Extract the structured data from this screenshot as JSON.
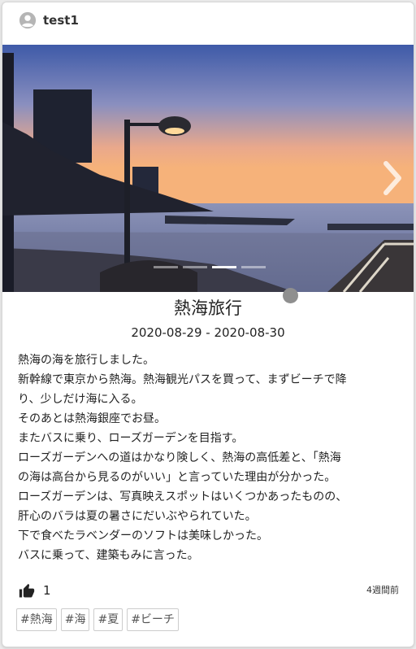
{
  "post": {
    "username": "test1",
    "title": "熱海旅行",
    "dates": "2020-08-29 - 2020-08-30",
    "body_lines": [
      "熱海の海を旅行しました。",
      "新幹線で東京から熱海。熱海観光パスを買って、まずビーチで降",
      "り、少しだけ海に入る。",
      "そのあとは熱海銀座でお昼。",
      "またバスに乗り、ローズガーデンを目指す。",
      "ローズガーデンへの道はかなり険しく、熱海の高低差と、「熱海",
      "の海は高台から見るのがいい」と言っていた理由が分かった。",
      "ローズガーデンは、写真映えスポットはいくつかあったものの、",
      "肝心のバラは夏の暑さにだいぶやられていた。",
      "下で食べたラベンダーのソフトは美味しかった。",
      "バスに乗って、建築もみに言った。"
    ],
    "likes": "1",
    "timestamp": "4週間前",
    "tags": [
      "#熱海",
      "#海",
      "#夏",
      "#ビーチ"
    ]
  },
  "carousel": {
    "slide_count": 4,
    "active_index": 2
  },
  "icons": {
    "avatar": "account-circle-icon",
    "next": "chevron-right-icon",
    "like": "thumb-up-icon"
  },
  "colors": {
    "accent": "#222222",
    "muted": "#8f8f8f"
  }
}
